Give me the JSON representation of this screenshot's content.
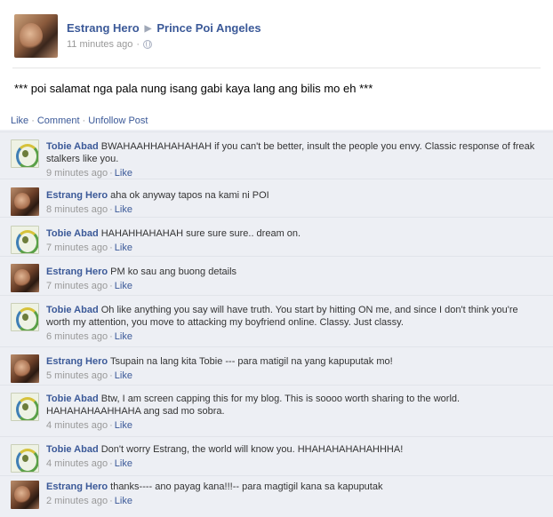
{
  "post": {
    "author": "Estrang Hero",
    "target": "Prince Poi Angeles",
    "time": "11 minutes ago",
    "text": "*** poi salamat nga pala nung isang gabi kaya lang ang bilis mo eh ***"
  },
  "actions": {
    "like": "Like",
    "comment": "Comment",
    "unfollow": "Unfollow Post",
    "separator": "·"
  },
  "comments": [
    {
      "author": "Tobie Abad",
      "avatar": "tobie",
      "text": "BWAHAAHHAHAHAHAH if you can't be better, insult the people you envy. Classic response of freak stalkers like you.",
      "time": "9 minutes ago",
      "like": "Like"
    },
    {
      "author": "Estrang Hero",
      "avatar": "estrang",
      "text": "aha ok anyway tapos na kami ni POI",
      "time": "8 minutes ago",
      "like": "Like"
    },
    {
      "author": "Tobie Abad",
      "avatar": "tobie",
      "text": "HAHAHHAHAHAH sure sure sure.. dream on.",
      "time": "7 minutes ago",
      "like": "Like"
    },
    {
      "author": "Estrang Hero",
      "avatar": "estrang",
      "text": "PM ko sau ang buong details",
      "time": "7 minutes ago",
      "like": "Like"
    },
    {
      "author": "Tobie Abad",
      "avatar": "tobie",
      "text": "Oh like anything you say will have truth. You start by hitting ON me, and since I don't think you're worth my attention, you move to attacking my boyfriend online. Classy. Just classy.",
      "time": "6 minutes ago",
      "like": "Like"
    },
    {
      "author": "Estrang Hero",
      "avatar": "estrang",
      "text": "Tsupain na lang kita Tobie --- para matigil na yang kapuputak mo!",
      "time": "5 minutes ago",
      "like": "Like"
    },
    {
      "author": "Tobie Abad",
      "avatar": "tobie",
      "text": "Btw, I am screen capping this for my blog. This is soooo worth sharing to the world. HAHAHAHAAHHAHA ang sad mo sobra.",
      "time": "4 minutes ago",
      "like": "Like"
    },
    {
      "author": "Tobie Abad",
      "avatar": "tobie",
      "text": "Don't worry Estrang, the world will know you. HHAHAHAHAHAHHHA!",
      "time": "4 minutes ago",
      "like": "Like"
    },
    {
      "author": "Estrang Hero",
      "avatar": "estrang",
      "text": "thanks---- ano payag kana!!!-- para magtigil kana sa kapuputak",
      "time": "2 minutes ago",
      "like": "Like"
    }
  ]
}
